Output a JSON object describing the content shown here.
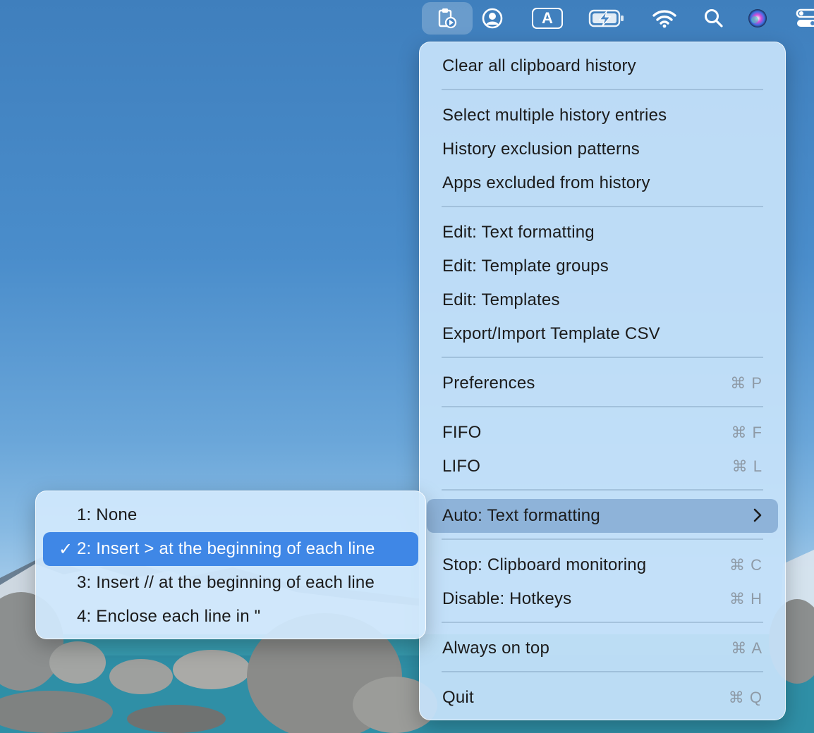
{
  "menubar": {
    "icons": [
      "clipboard-app-icon",
      "user-account-icon",
      "input-source-icon",
      "battery-charging-icon",
      "wifi-icon",
      "spotlight-search-icon",
      "siri-icon",
      "control-center-icon"
    ],
    "input_source_letter": "A"
  },
  "menu": {
    "clear_history": "Clear all clipboard history",
    "select_multiple": "Select multiple history entries",
    "exclusion_patterns": "History exclusion patterns",
    "apps_excluded": "Apps excluded from history",
    "edit_text_formatting": "Edit: Text formatting",
    "edit_template_groups": "Edit: Template groups",
    "edit_templates": "Edit: Templates",
    "export_import": "Export/Import Template CSV",
    "preferences": "Preferences",
    "preferences_shortcut": "⌘ P",
    "fifo": "FIFO",
    "fifo_shortcut": "⌘ F",
    "lifo": "LIFO",
    "lifo_shortcut": "⌘ L",
    "auto_text_formatting": "Auto: Text formatting",
    "stop_monitoring": "Stop: Clipboard monitoring",
    "stop_monitoring_shortcut": "⌘ C",
    "disable_hotkeys": "Disable: Hotkeys",
    "disable_hotkeys_shortcut": "⌘ H",
    "always_on_top": "Always on top",
    "always_on_top_shortcut": "⌘ A",
    "quit": "Quit",
    "quit_shortcut": "⌘ Q"
  },
  "submenu": {
    "items": [
      {
        "label": "1: None",
        "checked": false
      },
      {
        "label": "2: Insert > at the beginning of each line",
        "checked": true
      },
      {
        "label": "3: Insert // at the beginning of each line",
        "checked": false
      },
      {
        "label": "4: Enclose each line in \"",
        "checked": false
      }
    ],
    "check_glyph": "✓"
  },
  "colors": {
    "selection_accent": "#3f87e6",
    "hover_highlight": "#8eb3d9"
  }
}
